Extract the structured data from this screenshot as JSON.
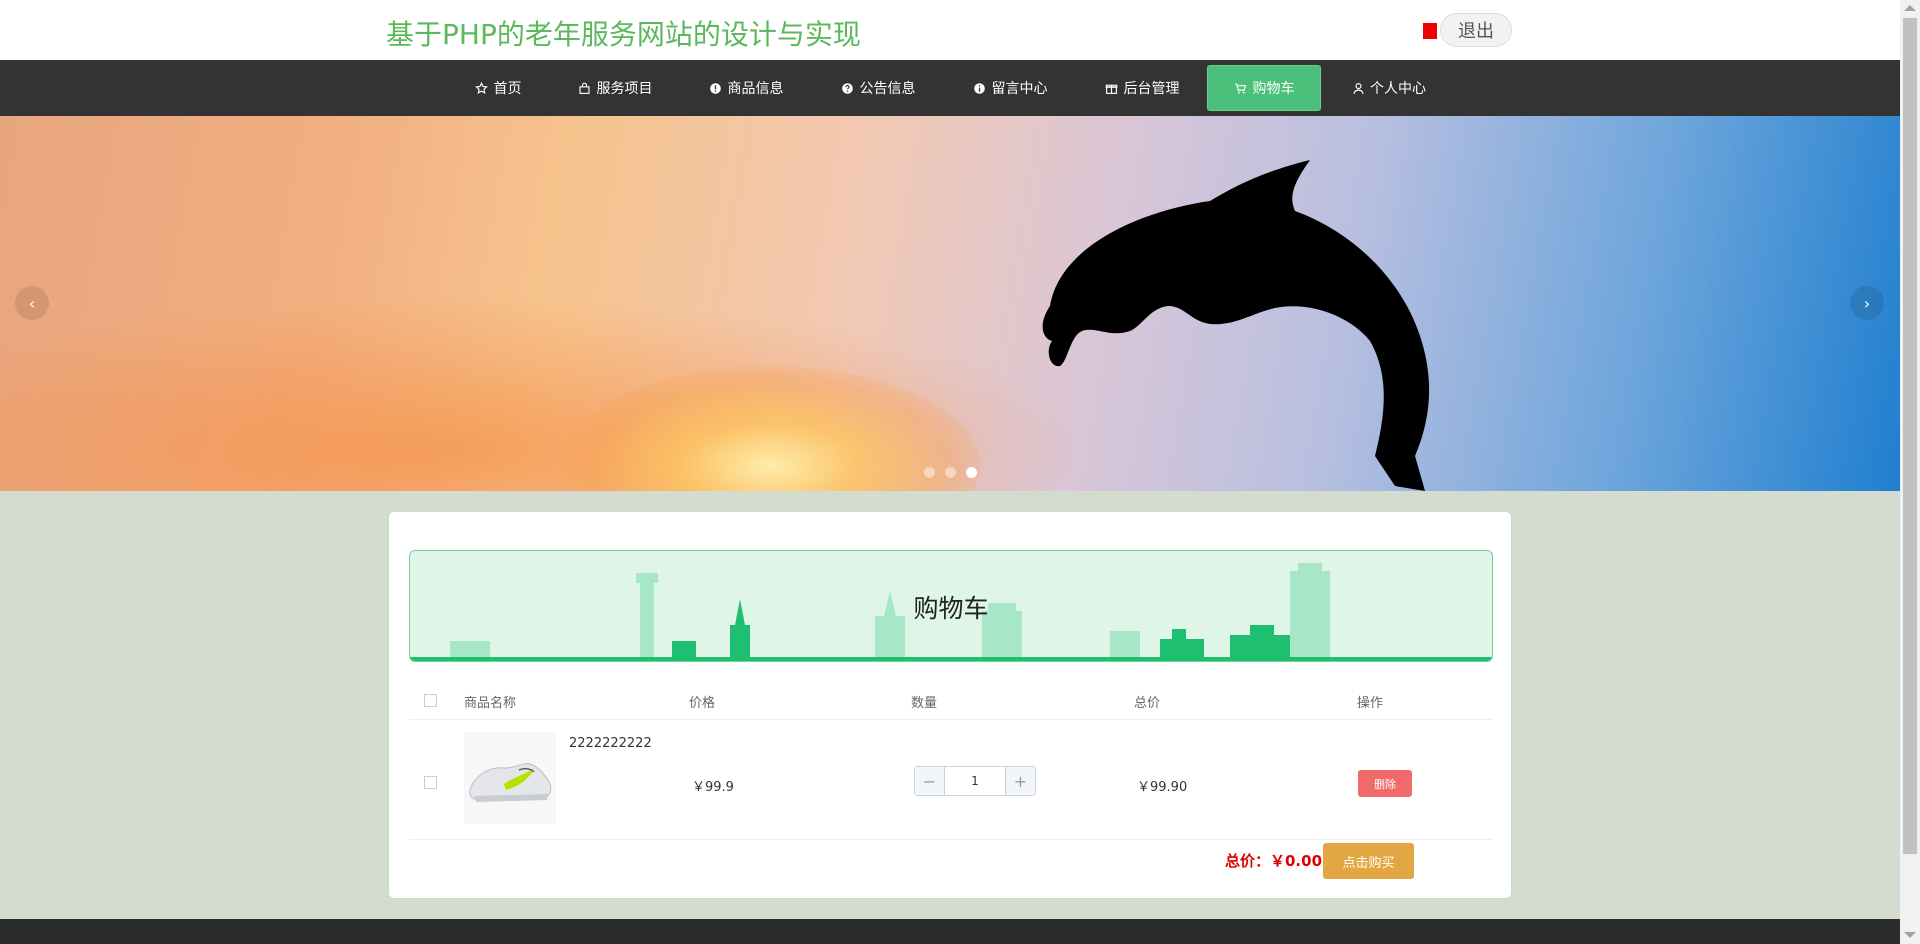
{
  "header": {
    "site_title": "基于PHP的老年服务网站的设计与实现",
    "logout_label": "退出"
  },
  "nav": {
    "items": [
      {
        "label": "首页",
        "icon": "star-icon"
      },
      {
        "label": "服务项目",
        "icon": "bag-icon"
      },
      {
        "label": "商品信息",
        "icon": "info-circle-icon"
      },
      {
        "label": "公告信息",
        "icon": "question-circle-icon"
      },
      {
        "label": "留言中心",
        "icon": "info-circle-icon"
      },
      {
        "label": "后台管理",
        "icon": "gift-icon"
      },
      {
        "label": "购物车",
        "icon": "cart-icon",
        "active": true
      },
      {
        "label": "个人中心",
        "icon": "user-icon"
      }
    ]
  },
  "banner": {
    "prev_label": "‹",
    "next_label": "›",
    "slide_count": 3,
    "active_slide": 3
  },
  "cart": {
    "title": "购物车",
    "columns": {
      "name": "商品名称",
      "price": "价格",
      "quantity": "数量",
      "subtotal": "总价",
      "action": "操作"
    },
    "items": [
      {
        "name": "2222222222",
        "price": "￥99.9",
        "quantity": "1",
        "subtotal": "￥99.90",
        "delete_label": "删除"
      }
    ],
    "qty_minus": "−",
    "qty_plus": "+",
    "total_label": "总价：￥0.00",
    "buy_label": "点击购买"
  },
  "colors": {
    "brand_green": "#5cb85c",
    "nav_active": "#4bc07a",
    "delete_red": "#f06a6a",
    "buy_orange": "#e2a642",
    "total_red": "#e00000"
  }
}
